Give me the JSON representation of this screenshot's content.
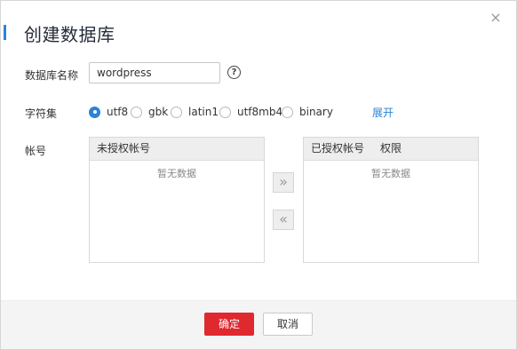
{
  "dialog": {
    "title": "创建数据库",
    "close_glyph": "×"
  },
  "form": {
    "db_name_label": "数据库名称",
    "db_name_value": "wordpress",
    "help_glyph": "?",
    "charset_label": "字符集",
    "charset_options": [
      {
        "label": "utf8",
        "selected": true
      },
      {
        "label": "gbk",
        "selected": false
      },
      {
        "label": "latin1",
        "selected": false
      },
      {
        "label": "utf8mb4",
        "selected": false
      },
      {
        "label": "binary",
        "selected": false
      }
    ],
    "expand_link": "展开",
    "account_label": "帐号"
  },
  "transfer": {
    "left_header": "未授权帐号",
    "left_empty": "暂无数据",
    "right_header_account": "已授权帐号",
    "right_header_permission": "权限",
    "right_empty": "暂无数据",
    "move_right_glyph": "»",
    "move_left_glyph": "«"
  },
  "footer": {
    "confirm_label": "确定",
    "cancel_label": "取消"
  },
  "colors": {
    "accent": "#2b83d8",
    "primary_button": "#e0282f",
    "footer_bg": "#f4f4f4"
  },
  "icons": {
    "close": "close-icon",
    "help": "help-circle-icon",
    "move_right": "double-chevron-right-icon",
    "move_left": "double-chevron-left-icon"
  }
}
